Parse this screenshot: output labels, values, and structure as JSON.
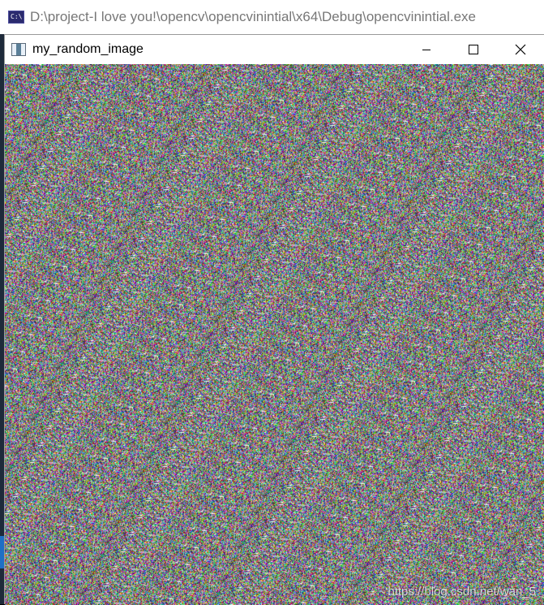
{
  "console": {
    "title": "D:\\project-I love you!\\opencv\\opencvinintial\\x64\\Debug\\opencvinintial.exe",
    "icon": "console-app-icon",
    "icon_text": "C:\\"
  },
  "window": {
    "title": "my_random_image",
    "icon": "opencv-window-icon",
    "buttons": {
      "minimize": "minimize-icon",
      "maximize": "maximize-icon",
      "close": "close-icon"
    }
  },
  "image": {
    "content": "random color noise",
    "mean_color": "#7f7f7f"
  },
  "watermark": "https://blog.csdn.net/wan_5"
}
